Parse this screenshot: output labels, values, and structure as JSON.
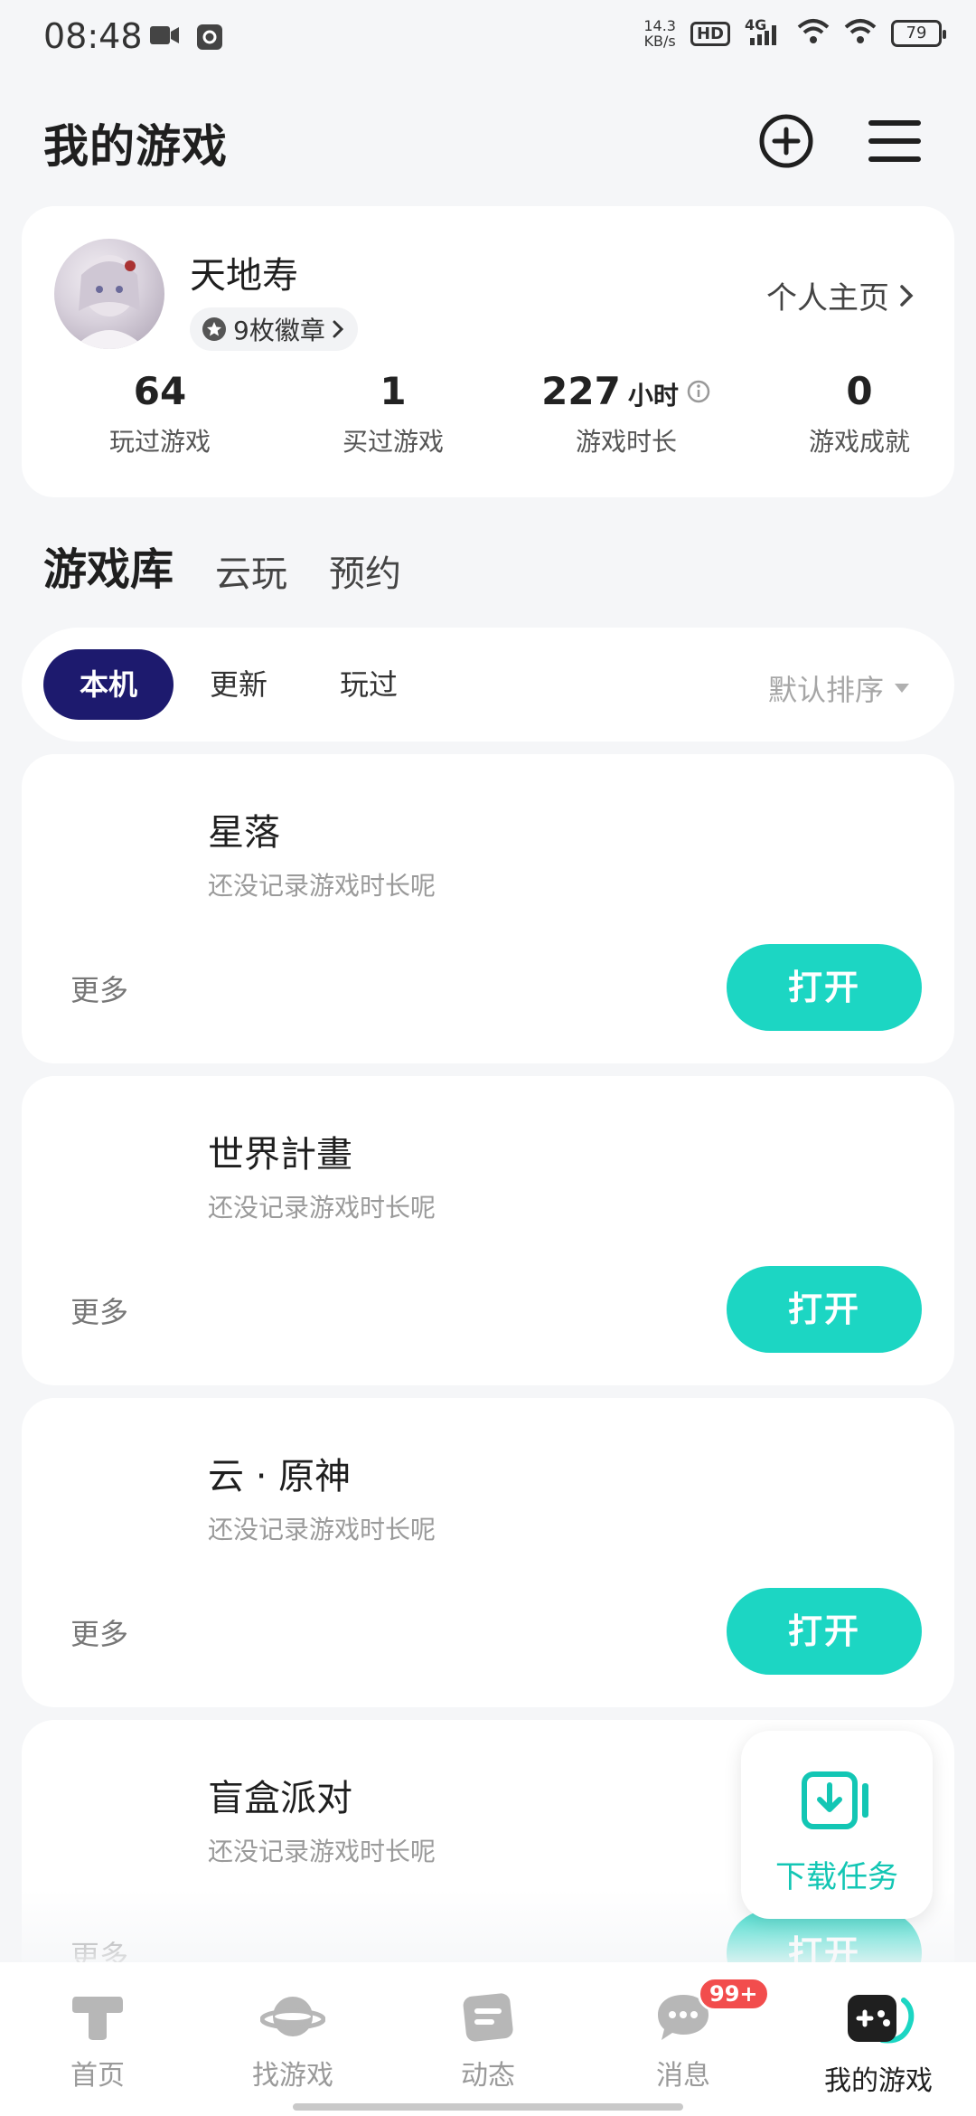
{
  "status_bar": {
    "time": "08:48",
    "net_speed_value": "14.3",
    "net_speed_unit": "KB/s",
    "hd_label": "HD",
    "signal_label": "4G",
    "battery": "79",
    "icons": [
      "video-camera-icon",
      "screen-record-icon",
      "signal-icon",
      "wifi-icon",
      "battery-icon"
    ]
  },
  "header": {
    "title": "我的游戏",
    "icons": [
      "add-circle-icon",
      "menu-icon"
    ]
  },
  "profile": {
    "username": "天地寿",
    "badges_label": "9枚徽章",
    "homepage_label": "个人主页",
    "stats": [
      {
        "value": "64",
        "unit": "",
        "label": "玩过游戏"
      },
      {
        "value": "1",
        "unit": "",
        "label": "买过游戏"
      },
      {
        "value": "227",
        "unit": "小时",
        "label": "游戏时长"
      },
      {
        "value": "0",
        "unit": "",
        "label": "游戏成就"
      }
    ]
  },
  "tabs": [
    "游戏库",
    "云玩",
    "预约"
  ],
  "filter": {
    "chips": [
      "本机",
      "更新",
      "玩过"
    ],
    "active_chip": "本机",
    "sort_label": "默认排序"
  },
  "games": [
    {
      "name": "星落",
      "subtitle": "还没记录游戏时长呢",
      "more_label": "更多",
      "action_label": "打开"
    },
    {
      "name": "世界計畫",
      "subtitle": "还没记录游戏时长呢",
      "more_label": "更多",
      "action_label": "打开"
    },
    {
      "name": "云 · 原神",
      "subtitle": "还没记录游戏时长呢",
      "more_label": "更多",
      "action_label": "打开"
    },
    {
      "name": "盲盒派对",
      "subtitle": "还没记录游戏时长呢",
      "more_label": "更多",
      "action_label": "打开"
    }
  ],
  "download_fab": {
    "label": "下载任务",
    "icon": "download-icon"
  },
  "bottom_nav": [
    {
      "label": "首页",
      "icon": "taptap-home-icon"
    },
    {
      "label": "找游戏",
      "icon": "planet-icon"
    },
    {
      "label": "动态",
      "icon": "feed-icon"
    },
    {
      "label": "消息",
      "icon": "chat-bubble-icon",
      "badge": "99+"
    },
    {
      "label": "我的游戏",
      "icon": "gamepad-icon",
      "active": true
    }
  ],
  "colors": {
    "accent": "#1cd6c3",
    "chip_active": "#1d1a6e",
    "badge_red": "#f24d4d"
  }
}
